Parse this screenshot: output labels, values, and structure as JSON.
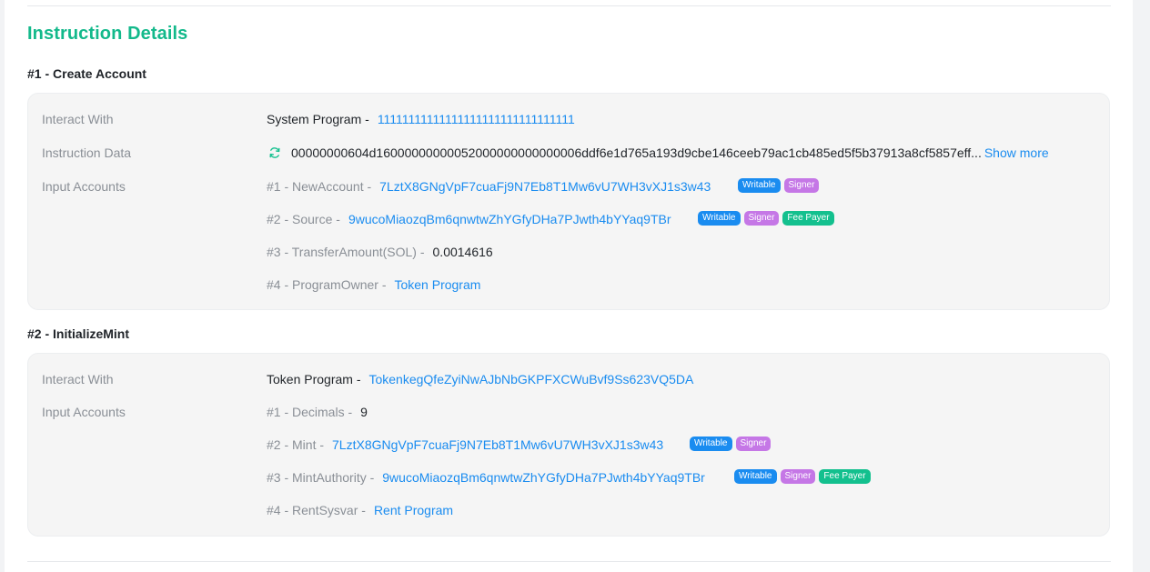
{
  "section": {
    "title": "Instruction Details"
  },
  "instructions": [
    {
      "heading": "#1 - Create Account",
      "interact_with": {
        "label": "Interact With",
        "program_name": "System Program -",
        "program_address": "11111111111111111111111111111111"
      },
      "instruction_data": {
        "label": "Instruction Data",
        "icon": "refresh-icon",
        "value": "00000000604d16000000000052000000000000006ddf6e1d765a193d9cbe146ceeb79ac1cb485ed5f5b37913a8cf5857eff...",
        "show_more": "Show more"
      },
      "input_accounts_label": "Input Accounts",
      "accounts": [
        {
          "prefix": "#1 - NewAccount -",
          "value": "7LztX8GNgVpF7cuaFj9N7Eb8T1Mw6vU7WH3vXJ1s3w43",
          "is_link": true,
          "badges": [
            "Writable",
            "Signer"
          ]
        },
        {
          "prefix": "#2 - Source -",
          "value": "9wucoMiaozqBm6qnwtwZhYGfyDHa7PJwth4bYYaq9TBr",
          "is_link": true,
          "badges": [
            "Writable",
            "Signer",
            "Fee Payer"
          ]
        },
        {
          "prefix": "#3 - TransferAmount(SOL) -",
          "value": "0.0014616",
          "is_link": false,
          "badges": []
        },
        {
          "prefix": "#4 - ProgramOwner -",
          "value": "Token Program",
          "is_link": true,
          "badges": []
        }
      ]
    },
    {
      "heading": "#2 - InitializeMint",
      "interact_with": {
        "label": "Interact With",
        "program_name": "Token Program -",
        "program_address": "TokenkegQfeZyiNwAJbNbGKPFXCWuBvf9Ss623VQ5DA"
      },
      "input_accounts_label": "Input Accounts",
      "accounts": [
        {
          "prefix": "#1 - Decimals -",
          "value": "9",
          "is_link": false,
          "badges": []
        },
        {
          "prefix": "#2 - Mint -",
          "value": "7LztX8GNgVpF7cuaFj9N7Eb8T1Mw6vU7WH3vXJ1s3w43",
          "is_link": true,
          "badges": [
            "Writable",
            "Signer"
          ]
        },
        {
          "prefix": "#3 - MintAuthority -",
          "value": "9wucoMiaozqBm6qnwtwZhYGfyDHa7PJwth4bYYaq9TBr",
          "is_link": true,
          "badges": [
            "Writable",
            "Signer",
            "Fee Payer"
          ]
        },
        {
          "prefix": "#4 - RentSysvar -",
          "value": "Rent Program",
          "is_link": true,
          "badges": []
        }
      ]
    }
  ],
  "colors": {
    "accent_green": "#13b98b",
    "link_blue": "#1a8cf0",
    "badge_writable": "#1a8cf0",
    "badge_signer": "#c577e6",
    "badge_fee_payer": "#13c08e"
  }
}
